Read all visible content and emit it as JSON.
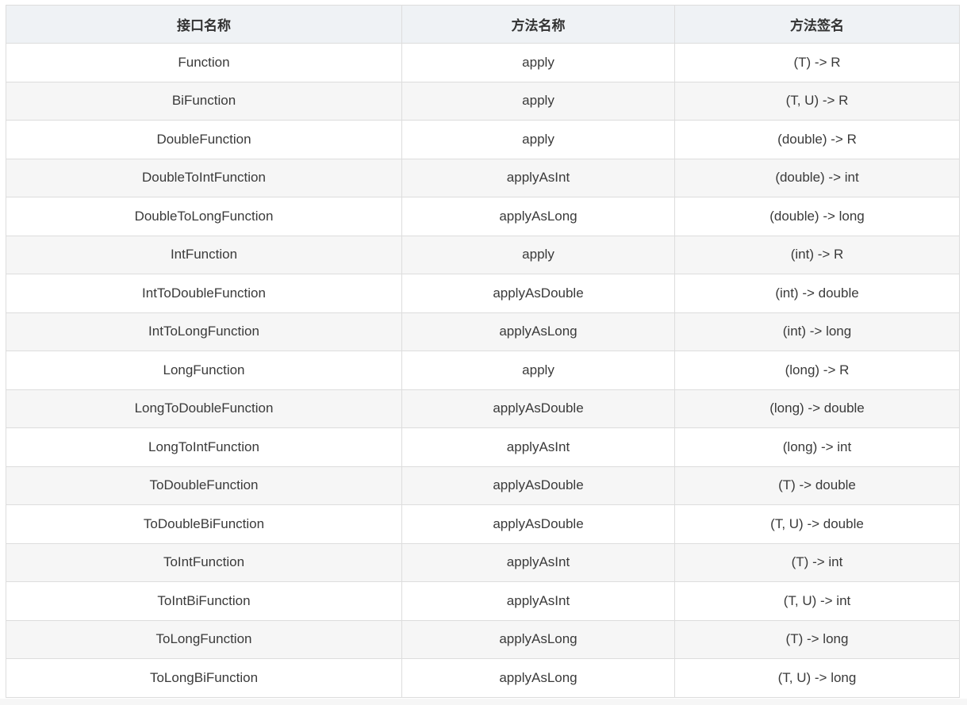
{
  "table": {
    "headers": [
      "接口名称",
      "方法名称",
      "方法签名"
    ],
    "rows": [
      [
        "Function",
        "apply",
        "(T) -> R"
      ],
      [
        "BiFunction",
        "apply",
        "(T, U) -> R"
      ],
      [
        "DoubleFunction",
        "apply",
        "(double) -> R"
      ],
      [
        "DoubleToIntFunction",
        "applyAsInt",
        "(double) -> int"
      ],
      [
        "DoubleToLongFunction",
        "applyAsLong",
        "(double) -> long"
      ],
      [
        "IntFunction",
        "apply",
        "(int) -> R"
      ],
      [
        "IntToDoubleFunction",
        "applyAsDouble",
        "(int) -> double"
      ],
      [
        "IntToLongFunction",
        "applyAsLong",
        "(int) -> long"
      ],
      [
        "LongFunction",
        "apply",
        "(long) -> R"
      ],
      [
        "LongToDoubleFunction",
        "applyAsDouble",
        "(long) -> double"
      ],
      [
        "LongToIntFunction",
        "applyAsInt",
        "(long) -> int"
      ],
      [
        "ToDoubleFunction",
        "applyAsDouble",
        "(T) -> double"
      ],
      [
        "ToDoubleBiFunction",
        "applyAsDouble",
        "(T, U) -> double"
      ],
      [
        "ToIntFunction",
        "applyAsInt",
        "(T) -> int"
      ],
      [
        "ToIntBiFunction",
        "applyAsInt",
        "(T, U) -> int"
      ],
      [
        "ToLongFunction",
        "applyAsLong",
        "(T) -> long"
      ],
      [
        "ToLongBiFunction",
        "applyAsLong",
        "(T, U) -> long"
      ]
    ]
  }
}
